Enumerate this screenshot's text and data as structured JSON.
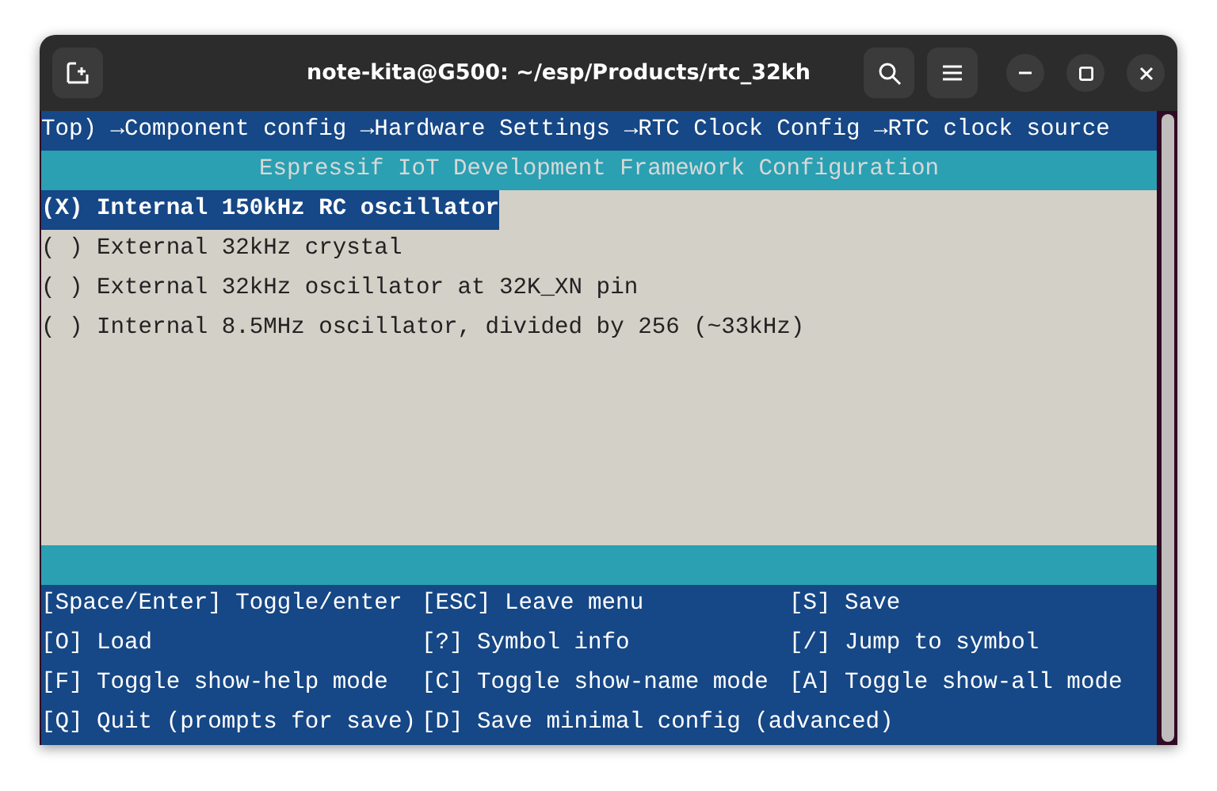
{
  "window": {
    "title": "note-kita@G500: ~/esp/Products/rtc_32kh"
  },
  "breadcrumb": "Top) →Component config →Hardware Settings →RTC Clock Config →RTC clock source",
  "menu_title": "Espressif IoT Development Framework Configuration",
  "options": [
    {
      "label": "(X) Internal 150kHz RC oscillator",
      "selected": true
    },
    {
      "label": "( ) External 32kHz crystal",
      "selected": false
    },
    {
      "label": "( ) External 32kHz oscillator at 32K_XN pin",
      "selected": false
    },
    {
      "label": "( ) Internal 8.5MHz oscillator, divided by 256 (~33kHz)",
      "selected": false
    }
  ],
  "help_rows": [
    [
      "[Space/Enter] Toggle/enter",
      "[ESC] Leave menu",
      "[S] Save"
    ],
    [
      "[O] Load",
      "[?] Symbol info",
      "[/] Jump to symbol"
    ],
    [
      "[F] Toggle show-help mode",
      "[C] Toggle show-name mode",
      "[A] Toggle show-all mode"
    ],
    [
      "[Q] Quit (prompts for save)",
      "[D] Save minimal config (advanced)"
    ]
  ]
}
